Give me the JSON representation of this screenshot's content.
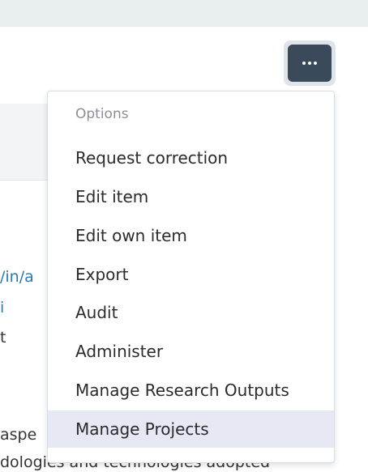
{
  "menu": {
    "header": "Options",
    "items": [
      {
        "label": "Request correction",
        "active": false
      },
      {
        "label": "Edit item",
        "active": false
      },
      {
        "label": "Edit own item",
        "active": false
      },
      {
        "label": "Export",
        "active": false
      },
      {
        "label": "Audit",
        "active": false
      },
      {
        "label": "Administer",
        "active": false
      },
      {
        "label": "Manage Research Outputs",
        "active": false
      },
      {
        "label": "Manage Projects",
        "active": true
      }
    ]
  },
  "button": {
    "icon": "ellipsis-icon"
  },
  "background": {
    "link1": "/in/a",
    "link2": "i",
    "text1": "t",
    "text2": "aspe",
    "text3": "dologies and technologies adopted"
  },
  "colors": {
    "button_bg": "#3b4a5a",
    "active_item_bg": "#e6e8f3",
    "link": "#2a7ab0"
  }
}
